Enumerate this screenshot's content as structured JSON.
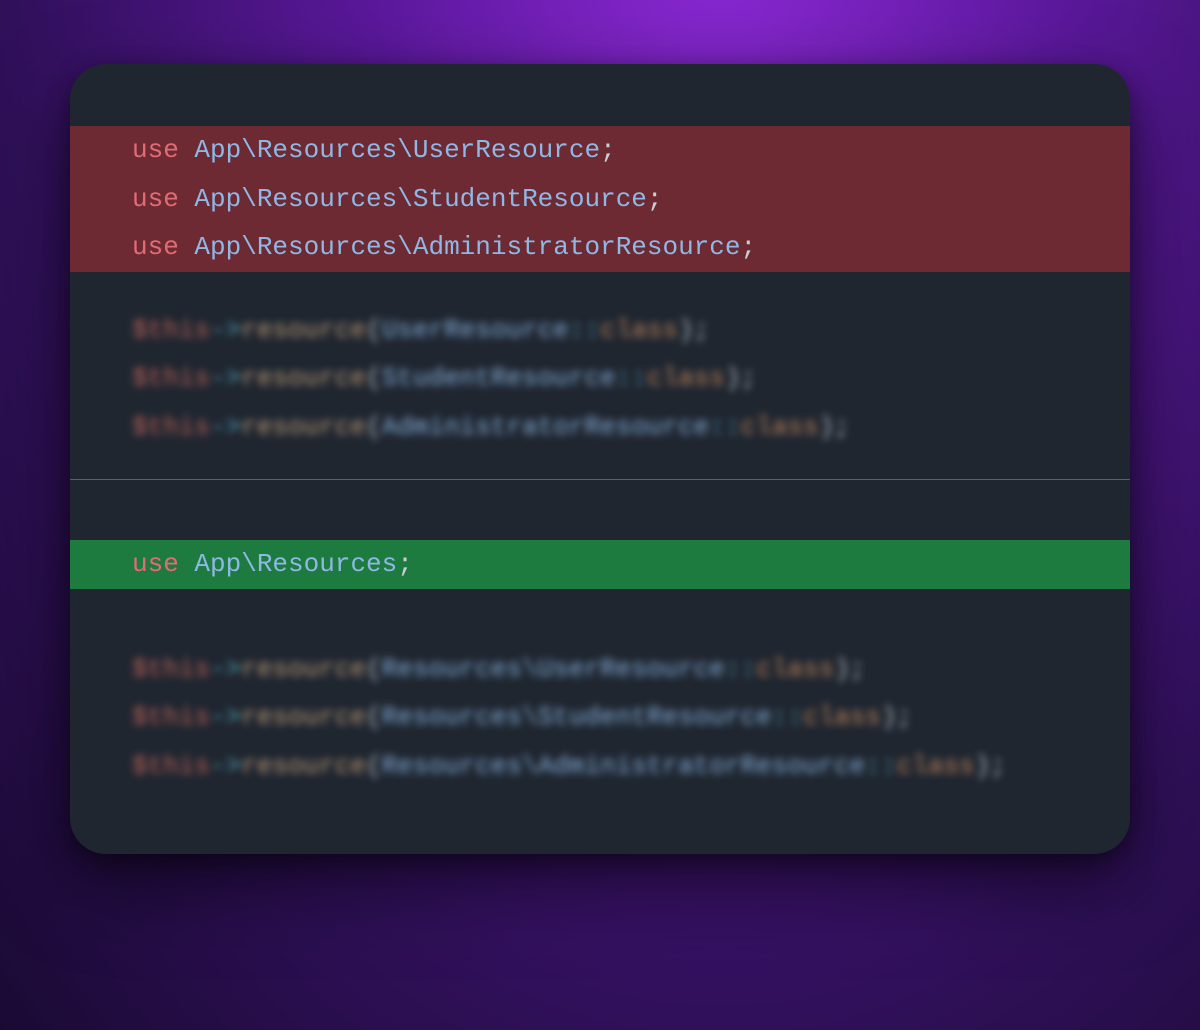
{
  "before": {
    "uses": [
      {
        "keyword": "use",
        "path": "App\\Resources\\UserResource",
        "semi": ";"
      },
      {
        "keyword": "use",
        "path": "App\\Resources\\StudentResource",
        "semi": ";"
      },
      {
        "keyword": "use",
        "path": "App\\Resources\\AdministratorResource",
        "semi": ";"
      }
    ],
    "calls": [
      {
        "var": "$this",
        "arrow": "->",
        "fn": "resource",
        "open": "(",
        "arg": "UserResource",
        "cc": "::",
        "clskw": "class",
        "close": ")",
        "semi": ";"
      },
      {
        "var": "$this",
        "arrow": "->",
        "fn": "resource",
        "open": "(",
        "arg": "StudentResource",
        "cc": "::",
        "clskw": "class",
        "close": ")",
        "semi": ";"
      },
      {
        "var": "$this",
        "arrow": "->",
        "fn": "resource",
        "open": "(",
        "arg": "AdministratorResource",
        "cc": "::",
        "clskw": "class",
        "close": ")",
        "semi": ";"
      }
    ]
  },
  "after": {
    "uses": [
      {
        "keyword": "use",
        "path": "App\\Resources",
        "semi": ";"
      }
    ],
    "calls": [
      {
        "var": "$this",
        "arrow": "->",
        "fn": "resource",
        "open": "(",
        "arg": "Resources\\UserResource",
        "cc": "::",
        "clskw": "class",
        "close": ")",
        "semi": ";"
      },
      {
        "var": "$this",
        "arrow": "->",
        "fn": "resource",
        "open": "(",
        "arg": "Resources\\StudentResource",
        "cc": "::",
        "clskw": "class",
        "close": ")",
        "semi": ";"
      },
      {
        "var": "$this",
        "arrow": "->",
        "fn": "resource",
        "open": "(",
        "arg": "Resources\\AdministratorResource",
        "cc": "::",
        "clskw": "class",
        "close": ")",
        "semi": ";"
      }
    ]
  }
}
